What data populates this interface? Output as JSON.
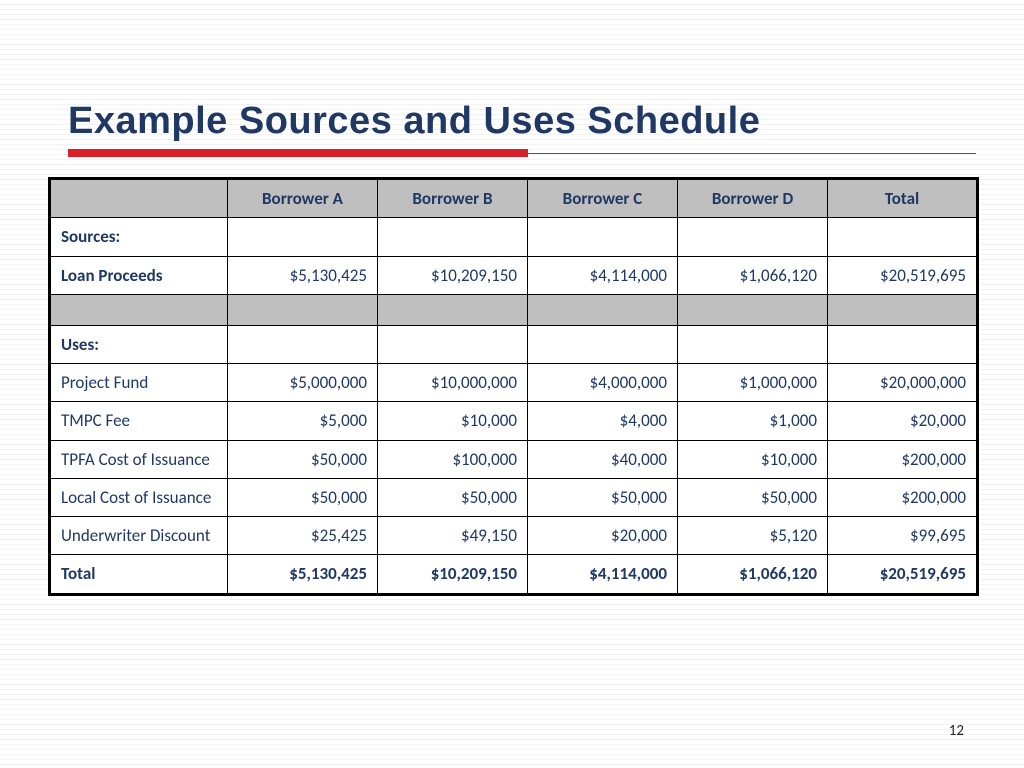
{
  "title": "Example Sources and Uses Schedule",
  "page_number": "12",
  "columns": [
    "Borrower A",
    "Borrower B",
    "Borrower C",
    "Borrower D",
    "Total"
  ],
  "sections": {
    "sources_label": "Sources:",
    "uses_label": "Uses:"
  },
  "rows": {
    "loan_proceeds": {
      "label": "Loan Proceeds",
      "values": [
        "$5,130,425",
        "$10,209,150",
        "$4,114,000",
        "$1,066,120",
        "$20,519,695"
      ]
    },
    "project_fund": {
      "label": "Project Fund",
      "values": [
        "$5,000,000",
        "$10,000,000",
        "$4,000,000",
        "$1,000,000",
        "$20,000,000"
      ]
    },
    "tmpc_fee": {
      "label": "TMPC Fee",
      "values": [
        "$5,000",
        "$10,000",
        "$4,000",
        "$1,000",
        "$20,000"
      ]
    },
    "tpfa_cost": {
      "label": "TPFA Cost of Issuance",
      "values": [
        "$50,000",
        "$100,000",
        "$40,000",
        "$10,000",
        "$200,000"
      ]
    },
    "local_cost": {
      "label": "Local Cost of Issuance",
      "values": [
        "$50,000",
        "$50,000",
        "$50,000",
        "$50,000",
        "$200,000"
      ]
    },
    "underwriter": {
      "label": "Underwriter Discount",
      "values": [
        "$25,425",
        "$49,150",
        "$20,000",
        "$5,120",
        "$99,695"
      ]
    },
    "total": {
      "label": "Total",
      "values": [
        "$5,130,425",
        "$10,209,150",
        "$4,114,000",
        "$1,066,120",
        "$20,519,695"
      ]
    }
  }
}
